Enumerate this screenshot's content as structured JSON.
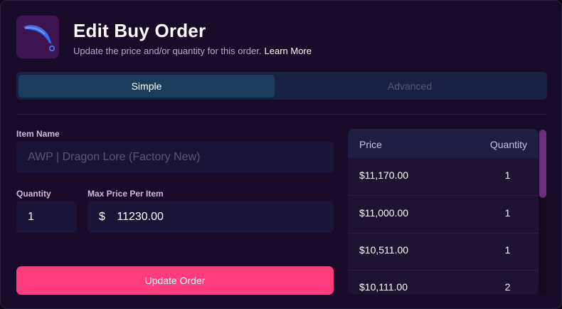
{
  "header": {
    "logo_icon": "karambit-knife-icon",
    "title": "Edit Buy Order",
    "subtitle": "Update the price and/or quantity for this order.",
    "learn_more": "Learn More"
  },
  "tabs": [
    {
      "label": "Simple",
      "active": true
    },
    {
      "label": "Advanced",
      "active": false
    }
  ],
  "form": {
    "item_name_label": "Item Name",
    "item_name_value": "AWP | Dragon Lore (Factory New)",
    "quantity_label": "Quantity",
    "quantity_value": "1",
    "max_price_label": "Max Price Per Item",
    "currency_symbol": "$",
    "max_price_value": "11230.00",
    "submit_label": "Update Order"
  },
  "order_book": {
    "columns": [
      "Price",
      "Quantity"
    ],
    "rows": [
      {
        "price": "$11,170.00",
        "quantity": "1"
      },
      {
        "price": "$11,000.00",
        "quantity": "1"
      },
      {
        "price": "$10,511.00",
        "quantity": "1"
      },
      {
        "price": "$10,111.00",
        "quantity": "2"
      }
    ]
  },
  "colors": {
    "accent": "#ff3d7e",
    "active_tab": "#1b3d5c",
    "panel": "#170b29",
    "scrollbar": "#6a2f7a"
  }
}
